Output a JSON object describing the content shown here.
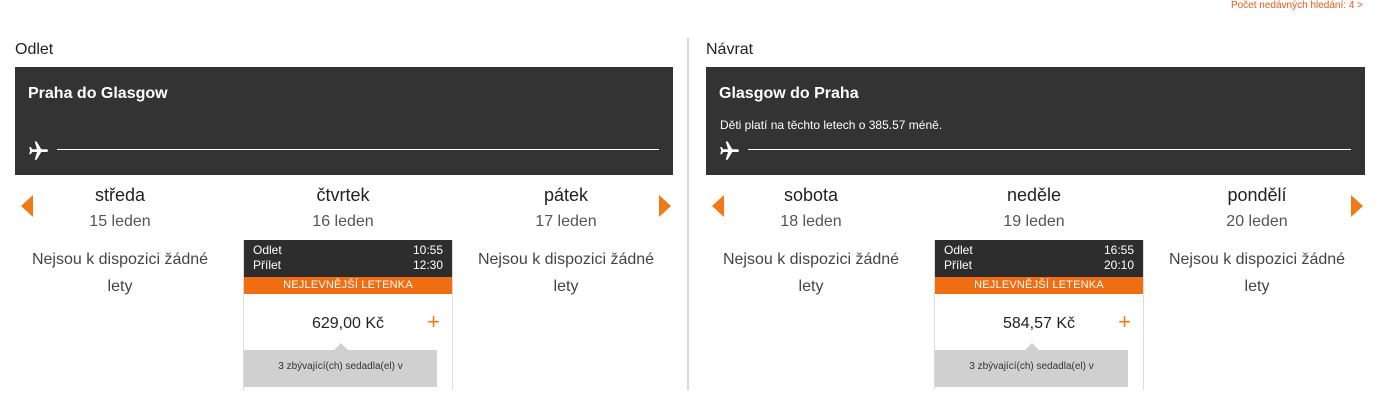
{
  "recent_searches": "Počet nedávných hledání: 4 >",
  "outbound": {
    "title": "Odlet",
    "route": "Praha do Glasgow",
    "note": "",
    "days": [
      {
        "name": "středa",
        "date": "15 leden",
        "status": "Nejsou k dispozici žádné lety"
      },
      {
        "name": "čtvrtek",
        "date": "16 leden",
        "card": {
          "depart_label": "Odlet",
          "depart_time": "10:55",
          "arrive_label": "Přílet",
          "arrive_time": "12:30",
          "badge": "NEJLEVNĚJŠÍ LETENKA",
          "price": "629,00 Kč",
          "seats": "3 zbývající(ch) sedadla(el) v"
        }
      },
      {
        "name": "pátek",
        "date": "17 leden",
        "status": "Nejsou k dispozici žádné lety"
      }
    ]
  },
  "return": {
    "title": "Návrat",
    "route": "Glasgow do Praha",
    "note": "Děti platí na těchto letech o 385.57 méně.",
    "days": [
      {
        "name": "sobota",
        "date": "18 leden",
        "status": "Nejsou k dispozici žádné lety"
      },
      {
        "name": "neděle",
        "date": "19 leden",
        "card": {
          "depart_label": "Odlet",
          "depart_time": "16:55",
          "arrive_label": "Přílet",
          "arrive_time": "20:10",
          "badge": "NEJLEVNĚJŠÍ LETENKA",
          "price": "584,57 Kč",
          "seats": "3 zbývající(ch) sedadla(el) v"
        }
      },
      {
        "name": "pondělí",
        "date": "20 leden",
        "status": "Nejsou k dispozici žádné lety"
      }
    ]
  },
  "colors": {
    "accent": "#f07a16",
    "badge": "#f06d12",
    "header_bg": "#333333"
  },
  "icons": {
    "plane": "airplane-icon",
    "prev": "arrow-left-icon",
    "next": "arrow-right-icon",
    "add": "plus-icon"
  }
}
